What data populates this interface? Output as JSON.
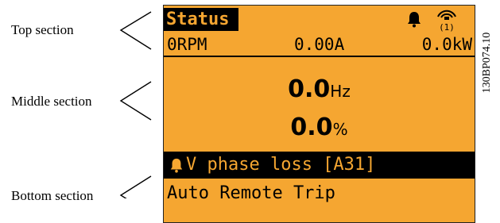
{
  "labels": {
    "top": "Top section",
    "middle": "Middle section",
    "bottom": "Bottom section"
  },
  "display": {
    "status_title": "Status",
    "rpm": "0RPM",
    "current": "0.00A",
    "power": "0.0kW",
    "frequency_value": "0.0",
    "frequency_unit": "Hz",
    "percent_value": "0.0",
    "percent_unit": "%",
    "alarm_text": "V phase loss [A31]",
    "trip_text": "Auto Remote Trip",
    "icons": [
      "bell-icon",
      "remote-control-icon",
      "bell-icon"
    ],
    "colors": {
      "display_bg": "#f5a631",
      "bar_bg": "#000000"
    }
  },
  "figure_id": "130BP074.10"
}
